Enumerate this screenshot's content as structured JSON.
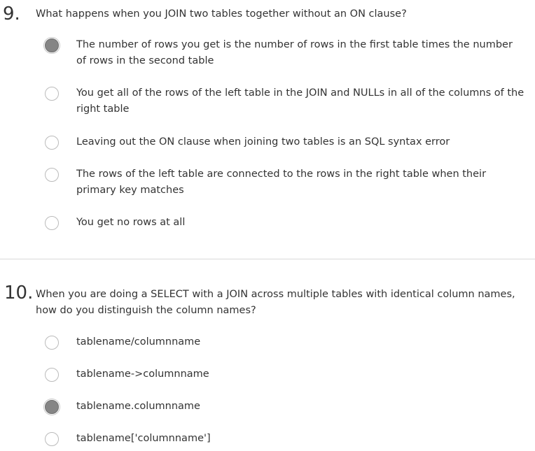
{
  "questions": [
    {
      "number": "9.",
      "text": "What happens when you JOIN two tables together without an ON clause?",
      "options": [
        {
          "label": "The number of rows you get is the number of rows in the first table times the number of rows in the second table",
          "selected": true
        },
        {
          "label": "You get all of the rows of the left table in the JOIN and NULLs in all of the columns of the right table",
          "selected": false
        },
        {
          "label": "Leaving out the ON clause when joining two tables is an SQL syntax error",
          "selected": false
        },
        {
          "label": "The rows of the left table are connected to the rows in the right table when their primary key matches",
          "selected": false
        },
        {
          "label": "You get no rows at all",
          "selected": false
        }
      ]
    },
    {
      "number": "10.",
      "text": "When you are doing a SELECT with a JOIN across multiple tables with identical column names, how do you distinguish the column names?",
      "options": [
        {
          "label": "tablename/columnname",
          "selected": false
        },
        {
          "label": "tablename->columnname",
          "selected": false
        },
        {
          "label": "tablename.columnname",
          "selected": true
        },
        {
          "label": "tablename['columnname']",
          "selected": false
        }
      ]
    }
  ]
}
